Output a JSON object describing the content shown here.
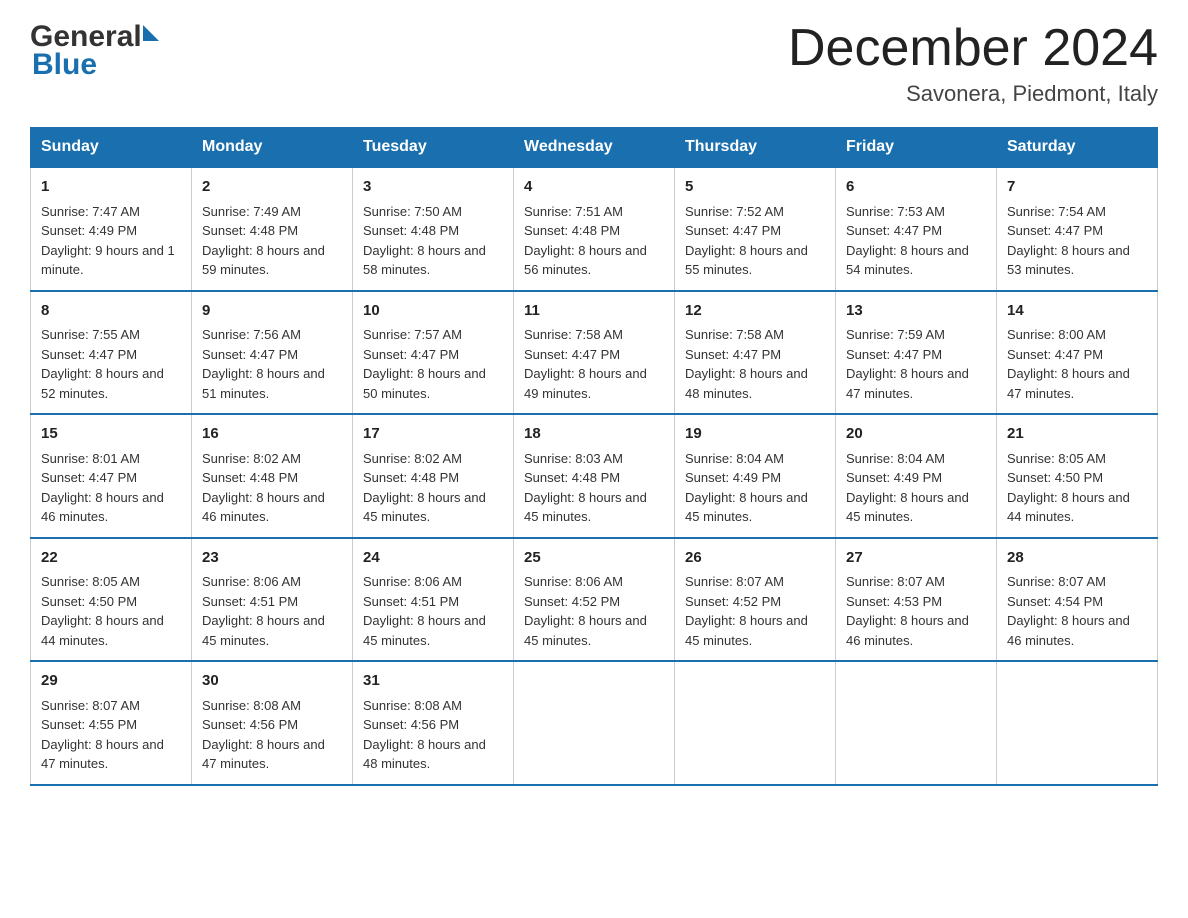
{
  "header": {
    "logo_general": "General",
    "logo_blue": "Blue",
    "month_title": "December 2024",
    "location": "Savonera, Piedmont, Italy"
  },
  "days_of_week": [
    "Sunday",
    "Monday",
    "Tuesday",
    "Wednesday",
    "Thursday",
    "Friday",
    "Saturday"
  ],
  "weeks": [
    [
      {
        "day": "1",
        "sunrise": "Sunrise: 7:47 AM",
        "sunset": "Sunset: 4:49 PM",
        "daylight": "Daylight: 9 hours and 1 minute."
      },
      {
        "day": "2",
        "sunrise": "Sunrise: 7:49 AM",
        "sunset": "Sunset: 4:48 PM",
        "daylight": "Daylight: 8 hours and 59 minutes."
      },
      {
        "day": "3",
        "sunrise": "Sunrise: 7:50 AM",
        "sunset": "Sunset: 4:48 PM",
        "daylight": "Daylight: 8 hours and 58 minutes."
      },
      {
        "day": "4",
        "sunrise": "Sunrise: 7:51 AM",
        "sunset": "Sunset: 4:48 PM",
        "daylight": "Daylight: 8 hours and 56 minutes."
      },
      {
        "day": "5",
        "sunrise": "Sunrise: 7:52 AM",
        "sunset": "Sunset: 4:47 PM",
        "daylight": "Daylight: 8 hours and 55 minutes."
      },
      {
        "day": "6",
        "sunrise": "Sunrise: 7:53 AM",
        "sunset": "Sunset: 4:47 PM",
        "daylight": "Daylight: 8 hours and 54 minutes."
      },
      {
        "day": "7",
        "sunrise": "Sunrise: 7:54 AM",
        "sunset": "Sunset: 4:47 PM",
        "daylight": "Daylight: 8 hours and 53 minutes."
      }
    ],
    [
      {
        "day": "8",
        "sunrise": "Sunrise: 7:55 AM",
        "sunset": "Sunset: 4:47 PM",
        "daylight": "Daylight: 8 hours and 52 minutes."
      },
      {
        "day": "9",
        "sunrise": "Sunrise: 7:56 AM",
        "sunset": "Sunset: 4:47 PM",
        "daylight": "Daylight: 8 hours and 51 minutes."
      },
      {
        "day": "10",
        "sunrise": "Sunrise: 7:57 AM",
        "sunset": "Sunset: 4:47 PM",
        "daylight": "Daylight: 8 hours and 50 minutes."
      },
      {
        "day": "11",
        "sunrise": "Sunrise: 7:58 AM",
        "sunset": "Sunset: 4:47 PM",
        "daylight": "Daylight: 8 hours and 49 minutes."
      },
      {
        "day": "12",
        "sunrise": "Sunrise: 7:58 AM",
        "sunset": "Sunset: 4:47 PM",
        "daylight": "Daylight: 8 hours and 48 minutes."
      },
      {
        "day": "13",
        "sunrise": "Sunrise: 7:59 AM",
        "sunset": "Sunset: 4:47 PM",
        "daylight": "Daylight: 8 hours and 47 minutes."
      },
      {
        "day": "14",
        "sunrise": "Sunrise: 8:00 AM",
        "sunset": "Sunset: 4:47 PM",
        "daylight": "Daylight: 8 hours and 47 minutes."
      }
    ],
    [
      {
        "day": "15",
        "sunrise": "Sunrise: 8:01 AM",
        "sunset": "Sunset: 4:47 PM",
        "daylight": "Daylight: 8 hours and 46 minutes."
      },
      {
        "day": "16",
        "sunrise": "Sunrise: 8:02 AM",
        "sunset": "Sunset: 4:48 PM",
        "daylight": "Daylight: 8 hours and 46 minutes."
      },
      {
        "day": "17",
        "sunrise": "Sunrise: 8:02 AM",
        "sunset": "Sunset: 4:48 PM",
        "daylight": "Daylight: 8 hours and 45 minutes."
      },
      {
        "day": "18",
        "sunrise": "Sunrise: 8:03 AM",
        "sunset": "Sunset: 4:48 PM",
        "daylight": "Daylight: 8 hours and 45 minutes."
      },
      {
        "day": "19",
        "sunrise": "Sunrise: 8:04 AM",
        "sunset": "Sunset: 4:49 PM",
        "daylight": "Daylight: 8 hours and 45 minutes."
      },
      {
        "day": "20",
        "sunrise": "Sunrise: 8:04 AM",
        "sunset": "Sunset: 4:49 PM",
        "daylight": "Daylight: 8 hours and 45 minutes."
      },
      {
        "day": "21",
        "sunrise": "Sunrise: 8:05 AM",
        "sunset": "Sunset: 4:50 PM",
        "daylight": "Daylight: 8 hours and 44 minutes."
      }
    ],
    [
      {
        "day": "22",
        "sunrise": "Sunrise: 8:05 AM",
        "sunset": "Sunset: 4:50 PM",
        "daylight": "Daylight: 8 hours and 44 minutes."
      },
      {
        "day": "23",
        "sunrise": "Sunrise: 8:06 AM",
        "sunset": "Sunset: 4:51 PM",
        "daylight": "Daylight: 8 hours and 45 minutes."
      },
      {
        "day": "24",
        "sunrise": "Sunrise: 8:06 AM",
        "sunset": "Sunset: 4:51 PM",
        "daylight": "Daylight: 8 hours and 45 minutes."
      },
      {
        "day": "25",
        "sunrise": "Sunrise: 8:06 AM",
        "sunset": "Sunset: 4:52 PM",
        "daylight": "Daylight: 8 hours and 45 minutes."
      },
      {
        "day": "26",
        "sunrise": "Sunrise: 8:07 AM",
        "sunset": "Sunset: 4:52 PM",
        "daylight": "Daylight: 8 hours and 45 minutes."
      },
      {
        "day": "27",
        "sunrise": "Sunrise: 8:07 AM",
        "sunset": "Sunset: 4:53 PM",
        "daylight": "Daylight: 8 hours and 46 minutes."
      },
      {
        "day": "28",
        "sunrise": "Sunrise: 8:07 AM",
        "sunset": "Sunset: 4:54 PM",
        "daylight": "Daylight: 8 hours and 46 minutes."
      }
    ],
    [
      {
        "day": "29",
        "sunrise": "Sunrise: 8:07 AM",
        "sunset": "Sunset: 4:55 PM",
        "daylight": "Daylight: 8 hours and 47 minutes."
      },
      {
        "day": "30",
        "sunrise": "Sunrise: 8:08 AM",
        "sunset": "Sunset: 4:56 PM",
        "daylight": "Daylight: 8 hours and 47 minutes."
      },
      {
        "day": "31",
        "sunrise": "Sunrise: 8:08 AM",
        "sunset": "Sunset: 4:56 PM",
        "daylight": "Daylight: 8 hours and 48 minutes."
      },
      null,
      null,
      null,
      null
    ]
  ]
}
